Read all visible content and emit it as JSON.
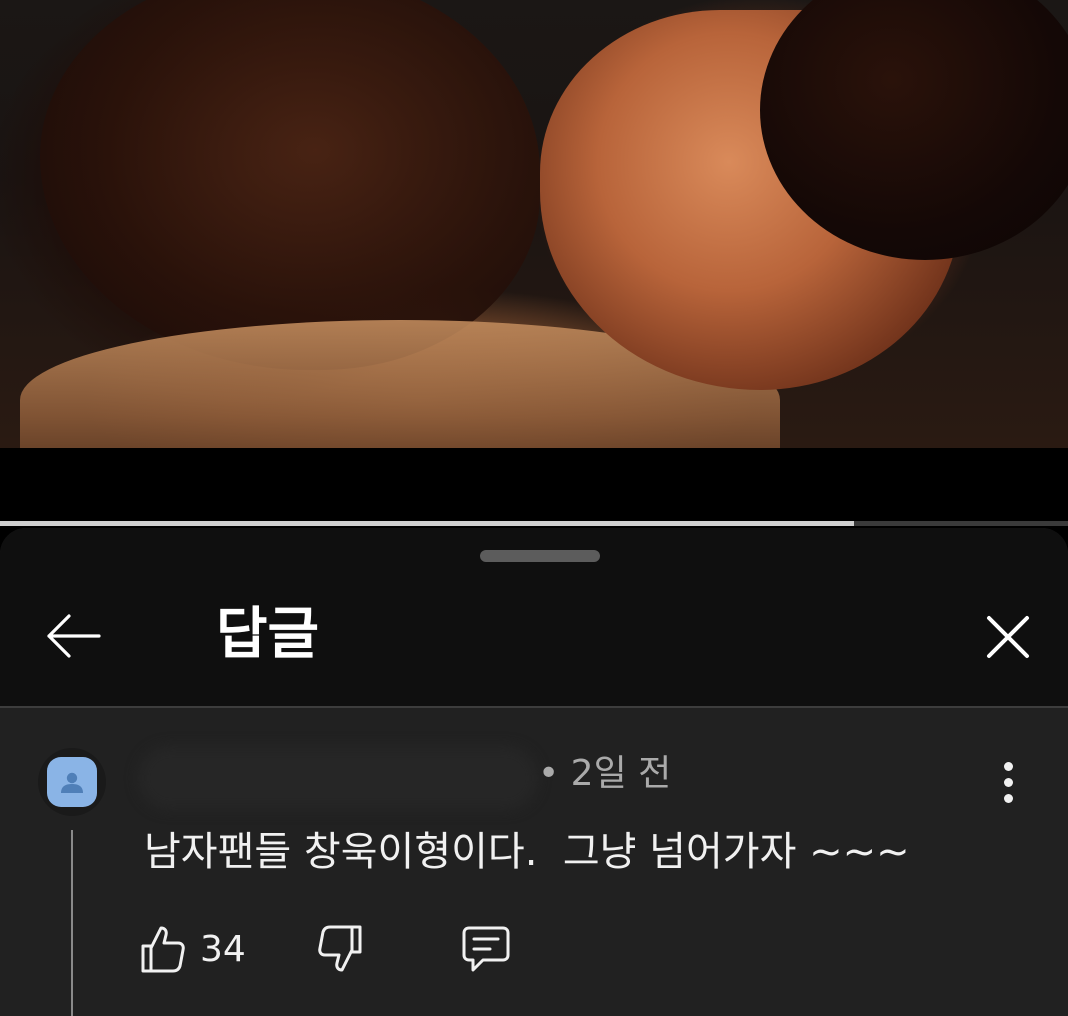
{
  "video": {
    "progress_fraction": 0.8
  },
  "panel": {
    "title": "답글"
  },
  "comment": {
    "time": "• 2일 전",
    "text": "남자팬들 창욱이형이다.  그냥 넘어가자 ~~~",
    "likes": "34"
  },
  "icons": {
    "back": "arrow-left-icon",
    "close": "close-icon",
    "more": "more-vertical-icon",
    "like": "thumbs-up-icon",
    "dislike": "thumbs-down-icon",
    "reply": "comment-icon",
    "avatar": "default-user-icon"
  },
  "colors": {
    "sheet_background": "#212121",
    "header_background": "#0f0f0f",
    "avatar_color": "#8ab4e6",
    "text_primary": "#f1f1f1",
    "text_secondary": "#aaaaaa"
  }
}
